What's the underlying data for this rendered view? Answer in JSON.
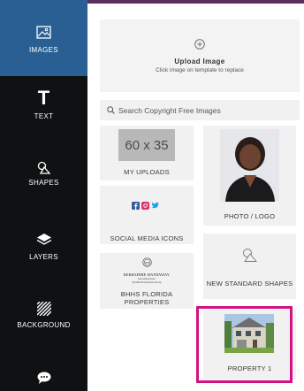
{
  "sidebar": {
    "items": [
      {
        "label": "IMAGES",
        "icon": "image-icon",
        "active": true
      },
      {
        "label": "TEXT",
        "icon": "text-icon",
        "glyph": "T"
      },
      {
        "label": "SHAPES",
        "icon": "shapes-icon"
      },
      {
        "label": "LAYERS",
        "icon": "layers-icon"
      },
      {
        "label": "BACKGROUND",
        "icon": "background-icon"
      },
      {
        "label": "",
        "icon": "chat-icon"
      }
    ]
  },
  "upload": {
    "title": "Upload Image",
    "subtitle": "Click image on template to replace",
    "icon": "plus-circle-icon"
  },
  "search": {
    "placeholder": "Search Copyright Free Images",
    "icon": "search-icon"
  },
  "tiles": {
    "my_uploads": {
      "thumb_text": "60 x 35",
      "label": "MY UPLOADS"
    },
    "photo_logo": {
      "label": "PHOTO / LOGO"
    },
    "social_media": {
      "label": "SOCIAL MEDIA ICONS"
    },
    "standard_shapes": {
      "label": "NEW STANDARD SHAPES"
    },
    "bhhs": {
      "label": "BHHS FLORIDA PROPERTIES",
      "logo_line1": "BERKSHIRE HATHAWAY",
      "logo_line2": "HomeServices",
      "logo_line3": "Florida Properties Group"
    },
    "property": {
      "label": "PROPERTY 1"
    }
  },
  "colors": {
    "sidebar_bg": "#0f1112",
    "active_bg": "#2a5f93",
    "tile_bg": "#f1f1f2",
    "highlight": "#d31184",
    "facebook": "#3b5998",
    "instagram": "#e1306c",
    "twitter": "#1da1f2"
  }
}
